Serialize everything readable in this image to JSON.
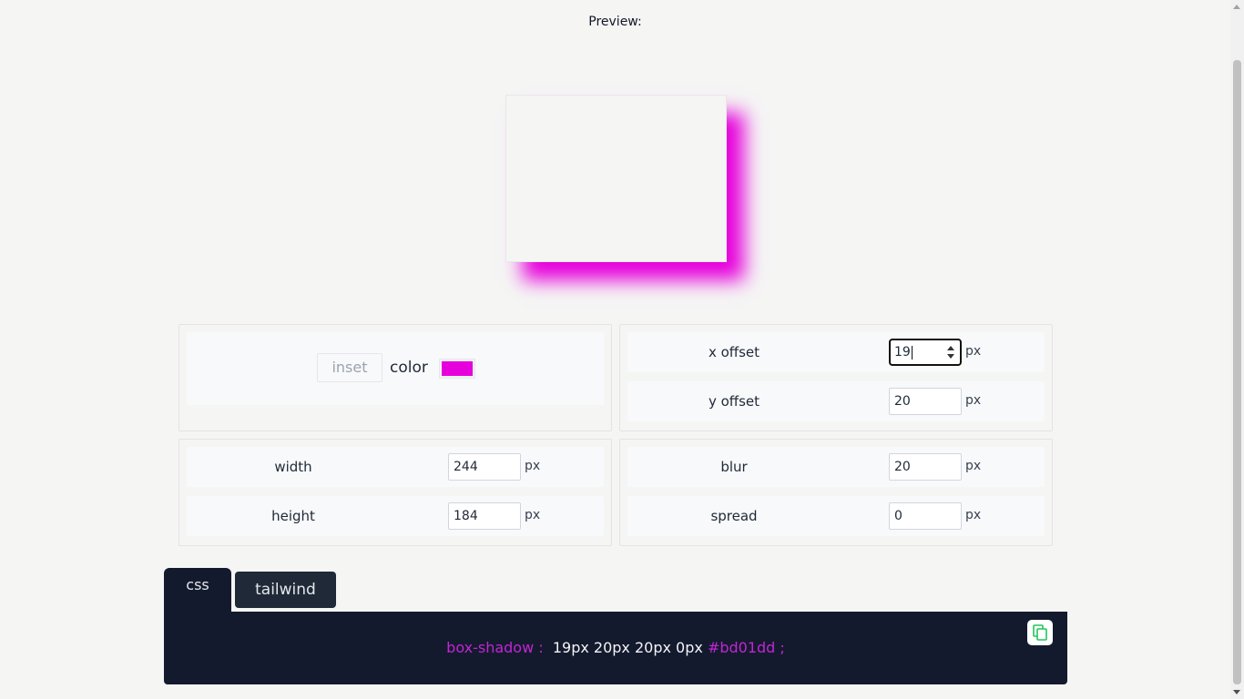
{
  "preview": {
    "title": "Preview:",
    "box_color": "#f5f5f4",
    "shadow_color": "#e600dc"
  },
  "controls": {
    "inset_label": "inset",
    "color_label": "color",
    "color_value": "#e600dc",
    "x_offset": {
      "label": "x offset",
      "value": "19",
      "unit": "px"
    },
    "y_offset": {
      "label": "y offset",
      "value": "20",
      "unit": "px"
    },
    "width": {
      "label": "width",
      "value": "244",
      "unit": "px"
    },
    "height": {
      "label": "height",
      "value": "184",
      "unit": "px"
    },
    "blur": {
      "label": "blur",
      "value": "20",
      "unit": "px"
    },
    "spread": {
      "label": "spread",
      "value": "0",
      "unit": "px"
    }
  },
  "tabs": {
    "css": "css",
    "tailwind": "tailwind"
  },
  "code": {
    "property": "box-shadow :",
    "values": "19px 20px 20px 0px",
    "color": "#bd01dd ;",
    "copy_icon": "copy-icon"
  }
}
